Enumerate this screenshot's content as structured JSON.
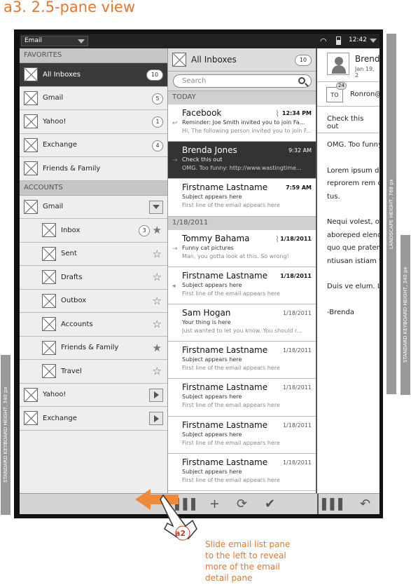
{
  "title": "a3. 2.5-pane view",
  "status": {
    "account": "Email",
    "time": "12:42"
  },
  "left": {
    "favorites_label": "FAVORITES",
    "favorites": [
      {
        "label": "All Inboxes",
        "badge": "10",
        "selected": true
      },
      {
        "label": "Gmail",
        "badge": "5"
      },
      {
        "label": "Yahoo!",
        "badge": "1"
      },
      {
        "label": "Exchange",
        "badge": "4"
      },
      {
        "label": "Friends & Family",
        "badge": ""
      }
    ],
    "accounts_label": "ACCOUNTS",
    "gmail": "Gmail",
    "folders": [
      {
        "label": "Inbox",
        "badge": "3",
        "starred": true
      },
      {
        "label": "Sent",
        "starred": false
      },
      {
        "label": "Drafts",
        "starred": false
      },
      {
        "label": "Outbox",
        "starred": false
      },
      {
        "label": "Accounts",
        "starred": false
      },
      {
        "label": "Friends & Family",
        "starred": true
      },
      {
        "label": "Travel",
        "starred": false
      }
    ],
    "yahoo": "Yahoo!",
    "exchange": "Exchange"
  },
  "mid": {
    "title": "All Inboxes",
    "count": "10",
    "search_placeholder": "Search",
    "today": "TODAY",
    "date_section": "1/18/2011",
    "messages": [
      {
        "from": "Facebook",
        "subj": "Reminder: Joe Smith invited you to join Fa...",
        "prev": "Hi, The following person invited you to join F...",
        "date": "12:34 PM"
      },
      {
        "from": "Brenda Jones",
        "subj": "Check this out",
        "prev": "OMG. Too funny: http://www.wastingtime...",
        "date": "9:32 AM"
      },
      {
        "from": "Firstname Lastname",
        "subj": "Subject appears here",
        "prev": "First line of the email appears here",
        "date": "7:59 AM"
      },
      {
        "from": "Tommy Bahama",
        "subj": "Funny cat pictures",
        "prev": "Man, you gotta look at this. So wrong!",
        "date": "1/18/2011"
      },
      {
        "from": "Firstname Lastname",
        "subj": "Subject appears here",
        "prev": "First line of the email appears here",
        "date": "1/18/2011"
      },
      {
        "from": "Sam Hogan",
        "subj": "Your thing is here",
        "prev": "Just wanted to let you know. You should r...",
        "date": "1/18/2011"
      },
      {
        "from": "Firstname Lastname",
        "subj": "Subject appears here",
        "prev": "First line of the email appears here",
        "date": "1/18/2011"
      },
      {
        "from": "Firstname Lastname",
        "subj": "Subject appears here",
        "prev": "First line of the email appears here",
        "date": "1/18/2011"
      },
      {
        "from": "Firstname Lastname",
        "subj": "Subject appears here",
        "prev": "First line of the email appears here",
        "date": "1/18/2011"
      },
      {
        "from": "Firstname Lastname",
        "subj": "Subject appears here",
        "prev": "First line of the email appears here",
        "date": "1/18/2011"
      }
    ]
  },
  "right": {
    "name": "Brend",
    "date": "Jan 19, 2",
    "to_label": "TO",
    "to_count": "24",
    "to_name": "Ronron@",
    "subject": "Check this out",
    "body": [
      "OMG. Too funny http://www.wa",
      "Lorem ipsum d tatur, is volupti reprorem rem c mint quatem al tus.",
      "Nequi volest, op iunt, apid que c aboreped elenc rum dusdae om quo que pratem velia pos intetu ntiusan istiam f",
      "Duis ve elum. L",
      "-Brenda"
    ]
  },
  "annotations": {
    "landscape": "LANDSCAPE HEIGHT, 768 px",
    "keyboard_right": "STANDARD KEYBOARD HEIGHT, 340 px",
    "keyboard_left": "STANDARD KEYBOARD HEIGHT, 340 px",
    "a2": "a2",
    "callout": "Slide email list pane to the left to reveal more of the email detail pane"
  }
}
